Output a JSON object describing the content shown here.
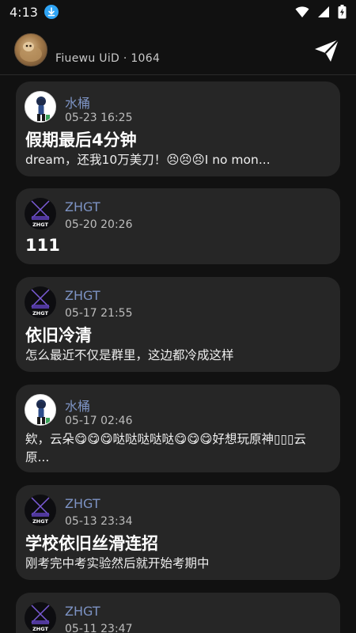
{
  "status_bar": {
    "time": "4:13",
    "icons": [
      "download-icon",
      "wifi-icon",
      "cell-signal-icon",
      "battery-charging-icon"
    ]
  },
  "header": {
    "uid_text": "Fiuewu UiD · 1064",
    "send_icon": "paper-plane-icon"
  },
  "posts": [
    {
      "author": "水桶",
      "avatar": "bucket-avatar",
      "time": "05-23 16:25",
      "title": "假期最后4分钟",
      "body": "dream，还我10万美刀！😣😣😣I no mon..."
    },
    {
      "author": "ZHGT",
      "avatar": "zhgt-avatar",
      "time": "05-20 20:26",
      "title": "111",
      "body": ""
    },
    {
      "author": "ZHGT",
      "avatar": "zhgt-avatar",
      "time": "05-17 21:55",
      "title": "依旧冷清",
      "body": "怎么最近不仅是群里，这边都冷成这样"
    },
    {
      "author": "水桶",
      "avatar": "bucket-avatar",
      "time": "05-17 02:46",
      "title": "",
      "body": "欸，云朵😋😋😋哒哒哒哒哒😋😋😋好想玩原神▯▯▯云原..."
    },
    {
      "author": "ZHGT",
      "avatar": "zhgt-avatar",
      "time": "05-13 23:34",
      "title": "学校依旧丝滑连招",
      "body": "刚考完中考实验然后就开始考期中"
    },
    {
      "author": "ZHGT",
      "avatar": "zhgt-avatar",
      "time": "05-11 23:47",
      "title": "",
      "body": ""
    }
  ],
  "avatar_label": "ZHGT",
  "colors": {
    "background": "#111111",
    "card": "#262626",
    "author_name": "#7d93c4",
    "download_badge": "#2fa4f5"
  }
}
